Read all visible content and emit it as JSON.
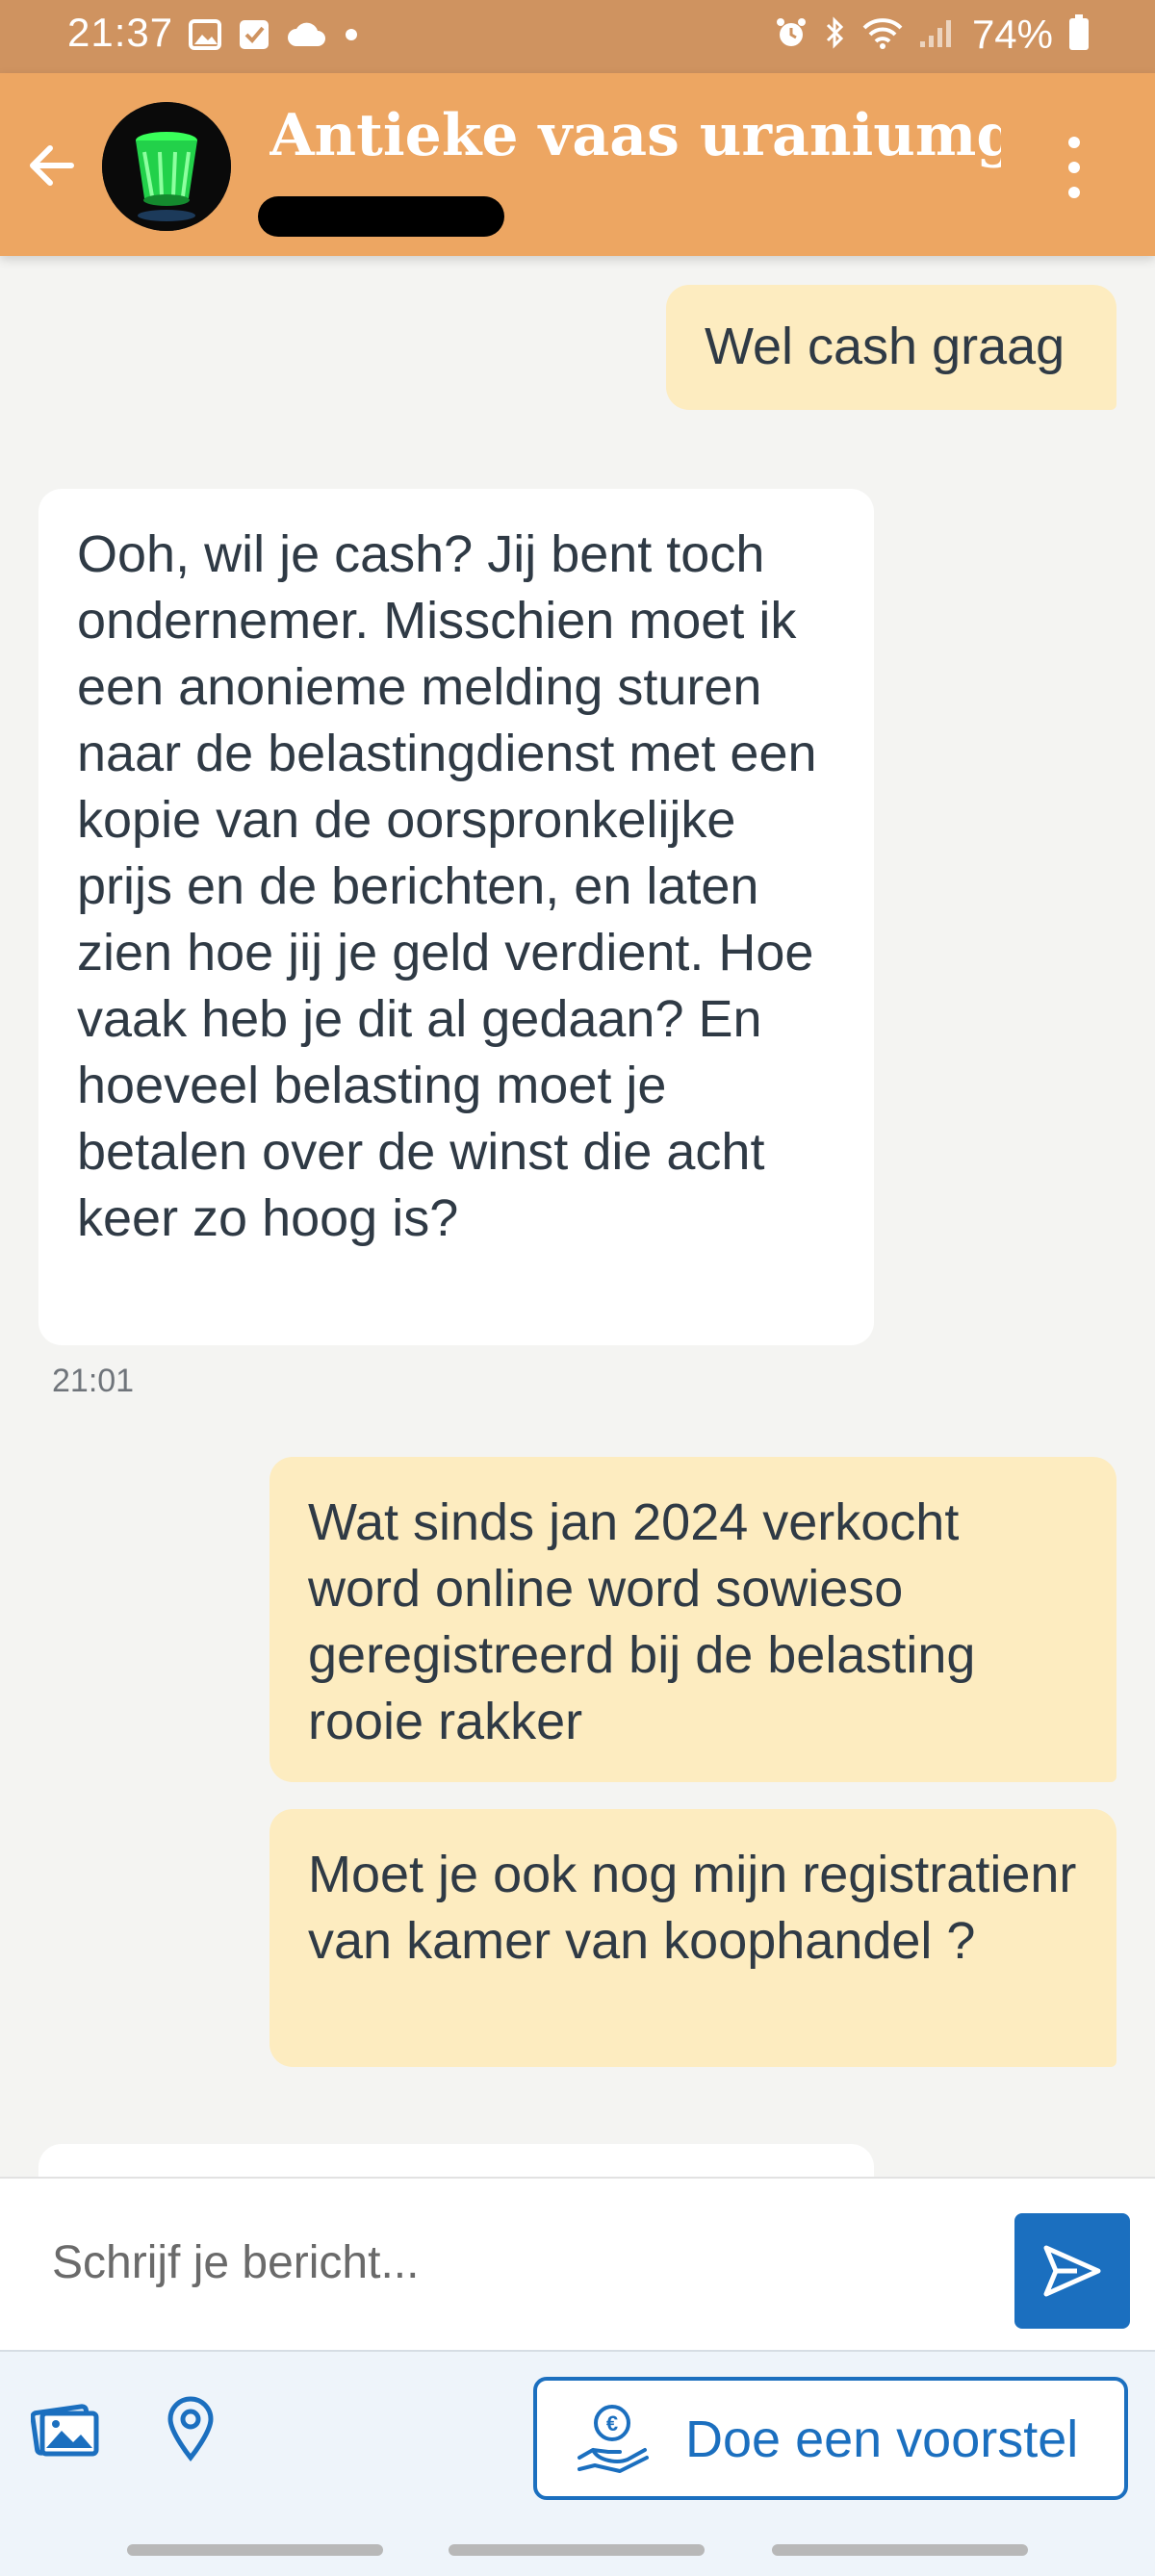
{
  "status_bar": {
    "time": "21:37",
    "left_icons": [
      "image-icon",
      "check-icon",
      "cloud-icon",
      "dot-icon"
    ],
    "right_icons": [
      "alarm-icon",
      "bluetooth-icon",
      "wifi-icon",
      "signal-icon",
      "battery-icon"
    ],
    "battery": "74%"
  },
  "header": {
    "title": "Antieke vaas uraniumg...",
    "subtitle": "(redacted)",
    "colors": {
      "bar": "#eda662",
      "status": "#cf9360"
    }
  },
  "messages": [
    {
      "id": "m1",
      "direction": "out",
      "text": "Wel cash graag"
    },
    {
      "id": "m2",
      "direction": "in",
      "text": "Ooh, wil je cash? Jij bent toch ondernemer. Misschien moet ik een anonieme melding sturen naar de belastingdienst met een kopie van de oorspronkelijke prijs en de berichten, en laten zien hoe jij je geld verdient. Hoe vaak heb je dit al gedaan? En hoeveel belasting moet je betalen over de winst die acht keer zo hoog is?",
      "time": "21:01"
    },
    {
      "id": "m3",
      "direction": "out",
      "text": "Wat sinds jan 2024 verkocht word online word sowieso geregistreerd bij de belasting rooie rakker"
    },
    {
      "id": "m4",
      "direction": "out",
      "text": "Moet je ook nog mijn registratienr van kamer van koophandel ?"
    }
  ],
  "composer": {
    "placeholder": "Schrijf je bericht...",
    "value": "",
    "send_icon": "send-icon"
  },
  "actions": {
    "photo_icon": "photos-icon",
    "location_icon": "location-pin-icon",
    "offer_label": "Doe een voorstel",
    "offer_icon": "euro-hand-icon",
    "accent": "#1b6fbf"
  }
}
